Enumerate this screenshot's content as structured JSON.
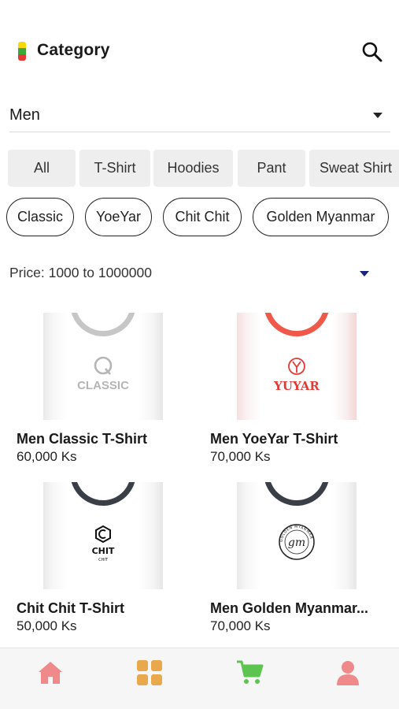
{
  "header": {
    "title": "Category"
  },
  "gender_dropdown": {
    "value": "Men"
  },
  "category_tabs": [
    {
      "label": "All"
    },
    {
      "label": "T-Shirt"
    },
    {
      "label": "Hoodies"
    },
    {
      "label": "Pant"
    },
    {
      "label": "Sweat Shirt"
    }
  ],
  "brand_chips": [
    {
      "label": "Classic"
    },
    {
      "label": "YoeYar"
    },
    {
      "label": "Chit Chit"
    },
    {
      "label": "Golden Myanmar"
    }
  ],
  "price_filter": {
    "label": "Price: 1000 to 1000000"
  },
  "products": [
    {
      "name": "Men Classic T-Shirt",
      "price": "60,000 Ks",
      "logo_text": "CLASSIC",
      "collar_color": "#c6c6c6",
      "logo_color": "#b5b5b5"
    },
    {
      "name": "Men YoeYar T-Shirt",
      "price": "70,000 Ks",
      "logo_text": "YUYAR",
      "collar_color": "#f0584a",
      "logo_color": "#e53935"
    },
    {
      "name": "Chit Chit T-Shirt",
      "price": "50,000 Ks",
      "logo_text": "CHIT",
      "logo_subtext": "CHIT",
      "collar_color": "#3a3f47",
      "logo_color": "#111111"
    },
    {
      "name": "Men Golden Myanmar...",
      "price": "70,000 Ks",
      "logo_text": "gm",
      "logo_ring_text": "GOLDEN MYANMAR",
      "collar_color": "#3a3f47",
      "logo_color": "#222222"
    }
  ],
  "bottom_nav": [
    {
      "icon": "home-icon",
      "color": "#f08a8a"
    },
    {
      "icon": "grid-icon",
      "color": "#e9a84c"
    },
    {
      "icon": "cart-icon",
      "color": "#5cc44f"
    },
    {
      "icon": "profile-icon",
      "color": "#f08a8a"
    }
  ],
  "colors": {
    "flag_top": "#f5d90a",
    "flag_mid": "#3aa83a",
    "flag_bottom": "#e53935",
    "price_caret": "#1a237e"
  }
}
